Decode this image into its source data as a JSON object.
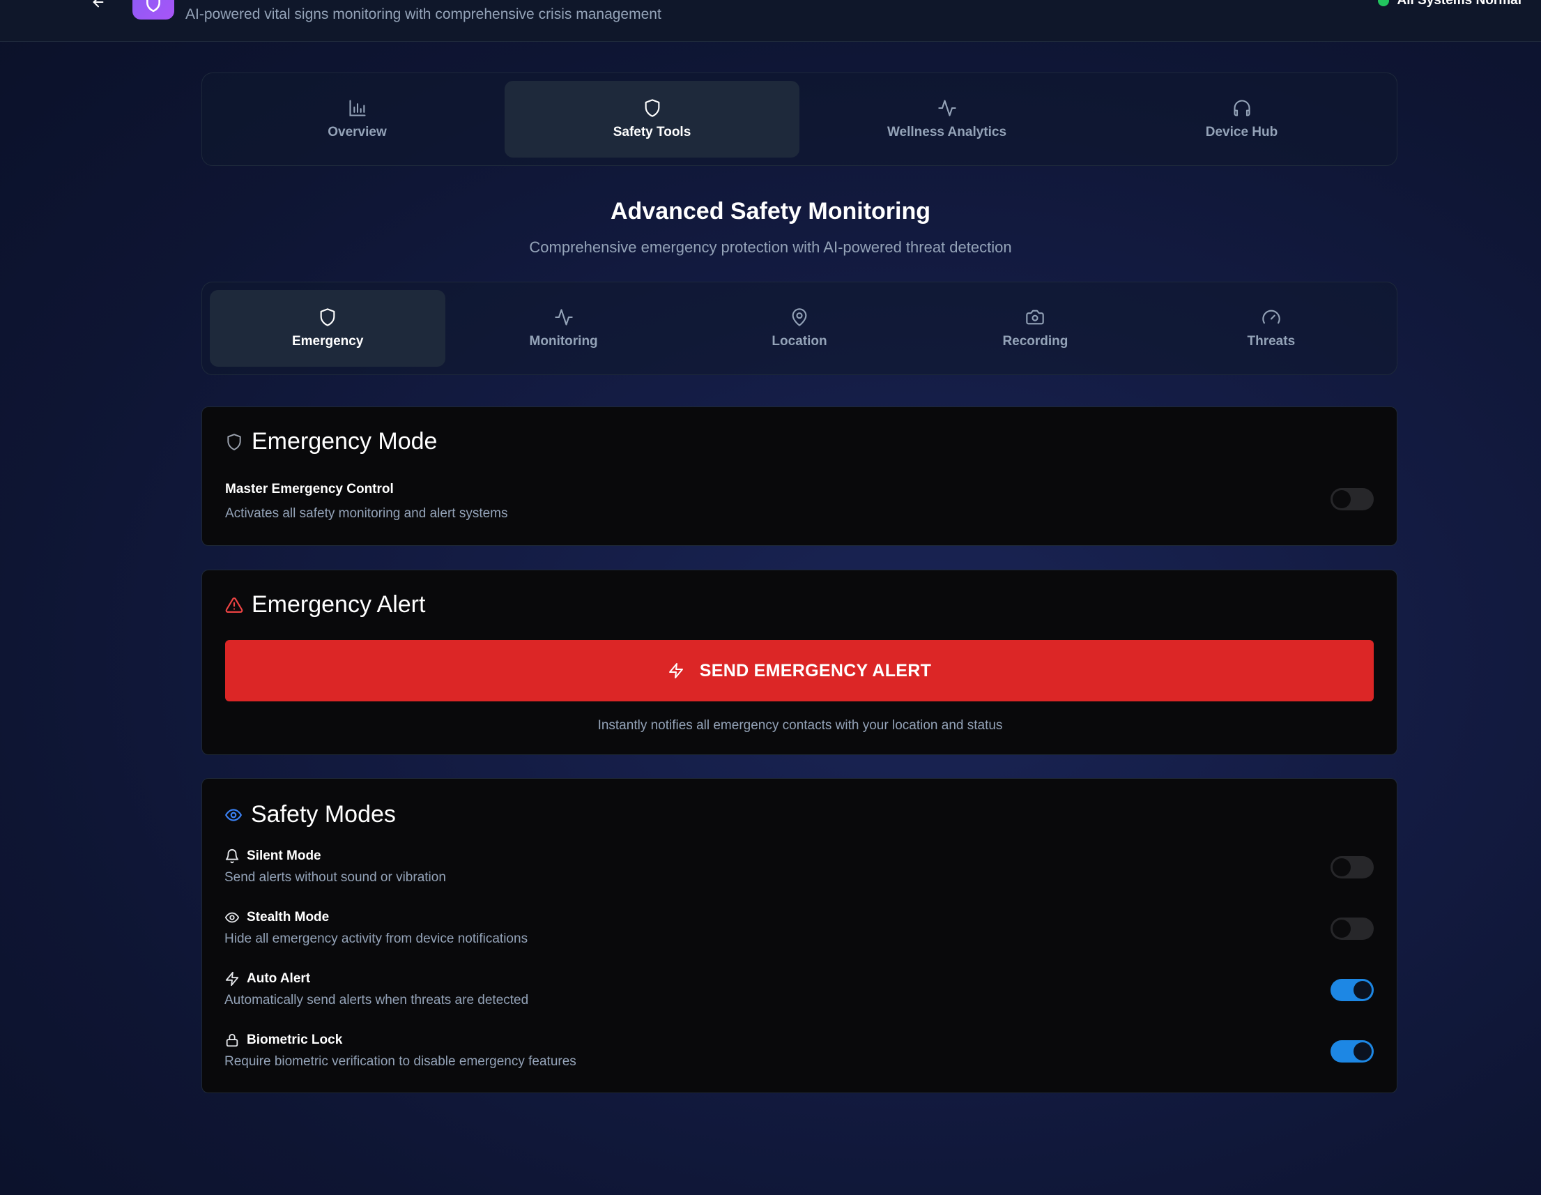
{
  "header": {
    "subtitle": "AI-powered vital signs monitoring with comprehensive crisis management",
    "status": "All Systems Normal",
    "status_color": "#22c55e"
  },
  "main_tabs": [
    {
      "label": "Overview",
      "icon": "bar-chart-icon",
      "active": false
    },
    {
      "label": "Safety Tools",
      "icon": "shield-icon",
      "active": true
    },
    {
      "label": "Wellness Analytics",
      "icon": "activity-icon",
      "active": false
    },
    {
      "label": "Device Hub",
      "icon": "headphones-icon",
      "active": false
    }
  ],
  "section": {
    "title": "Advanced Safety Monitoring",
    "subtitle": "Comprehensive emergency protection with AI-powered threat detection"
  },
  "sub_tabs": [
    {
      "label": "Emergency",
      "icon": "shield-icon",
      "active": true
    },
    {
      "label": "Monitoring",
      "icon": "activity-icon",
      "active": false
    },
    {
      "label": "Location",
      "icon": "map-pin-icon",
      "active": false
    },
    {
      "label": "Recording",
      "icon": "camera-icon",
      "active": false
    },
    {
      "label": "Threats",
      "icon": "gauge-icon",
      "active": false
    }
  ],
  "emergency_mode": {
    "title": "Emergency Mode",
    "control_label": "Master Emergency Control",
    "control_desc": "Activates all safety monitoring and alert systems",
    "enabled": false
  },
  "emergency_alert": {
    "title": "Emergency Alert",
    "button_label": "SEND EMERGENCY ALERT",
    "note": "Instantly notifies all emergency contacts with your location and status",
    "button_color": "#dc2626"
  },
  "safety_modes": {
    "title": "Safety Modes",
    "items": [
      {
        "label": "Silent Mode",
        "desc": "Send alerts without sound or vibration",
        "icon": "bell-icon",
        "enabled": false
      },
      {
        "label": "Stealth Mode",
        "desc": "Hide all emergency activity from device notifications",
        "icon": "eye-icon",
        "enabled": false
      },
      {
        "label": "Auto Alert",
        "desc": "Automatically send alerts when threats are detected",
        "icon": "zap-icon",
        "enabled": true
      },
      {
        "label": "Biometric Lock",
        "desc": "Require biometric verification to disable emergency features",
        "icon": "lock-icon",
        "enabled": true
      }
    ]
  }
}
